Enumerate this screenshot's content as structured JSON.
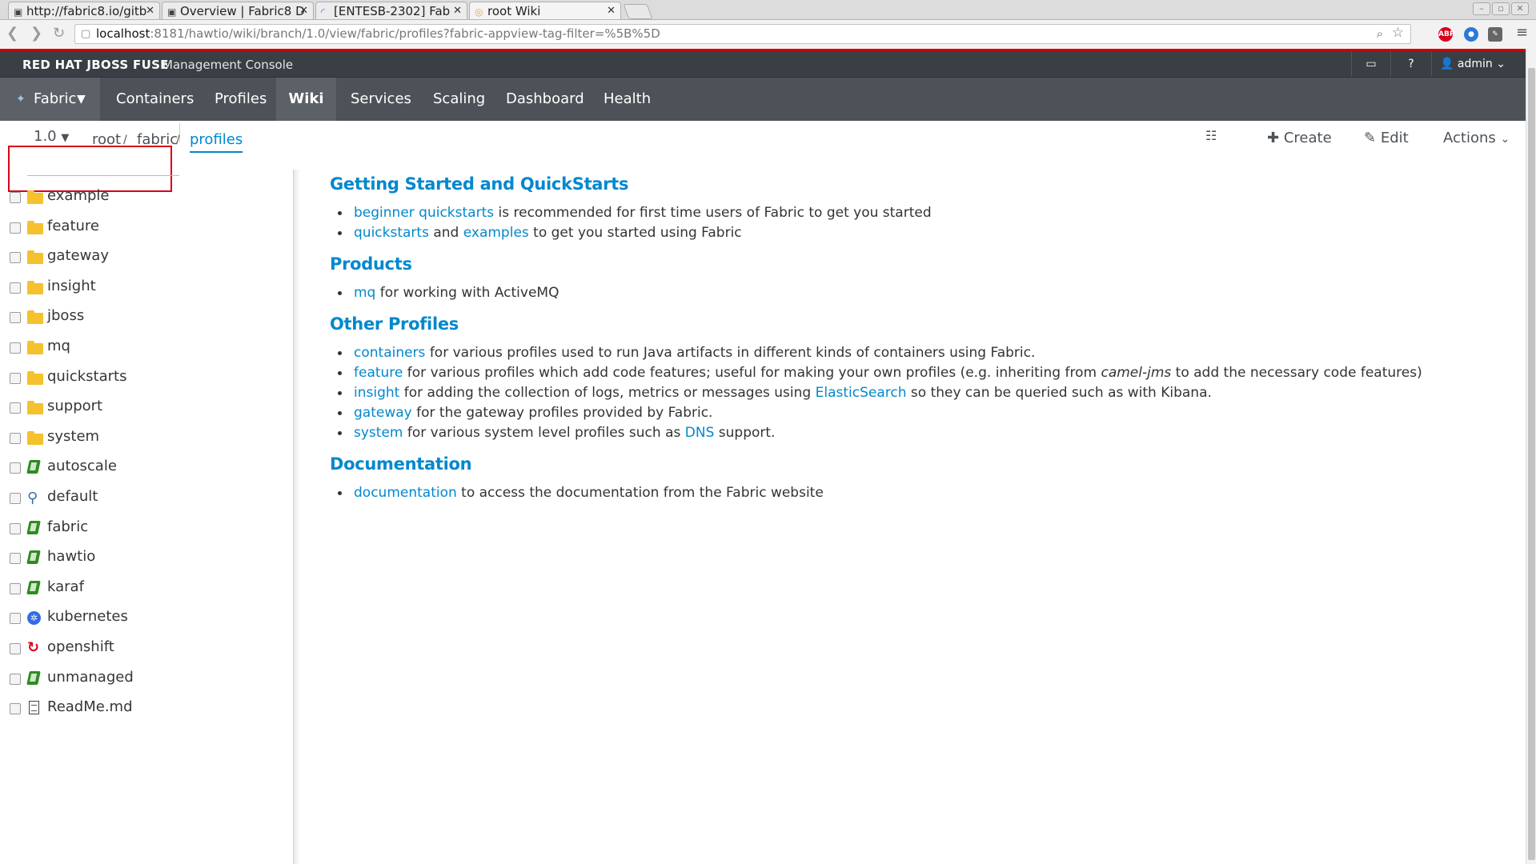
{
  "browser": {
    "tabs": [
      {
        "title": "http://fabric8.io/gitb"
      },
      {
        "title": "Overview | Fabric8 D"
      },
      {
        "title": "[ENTESB-2302] Fab"
      },
      {
        "title": "root Wiki"
      }
    ],
    "url_host": "localhost",
    "url_rest": ":8181/hawtio/wiki/branch/1.0/view/fabric/profiles?fabric-appview-tag-filter=%5B%5D"
  },
  "header": {
    "brand": "RED HAT JBOSS FUSE",
    "subtitle": "Management Console",
    "user": "admin"
  },
  "nav": {
    "fabric": "Fabric",
    "items": [
      "Containers",
      "Profiles",
      "Wiki",
      "Services",
      "Scaling",
      "Dashboard",
      "Health"
    ]
  },
  "toolbar": {
    "version": "1.0",
    "breadcrumb": [
      "root",
      "fabric",
      "profiles"
    ],
    "create": "Create",
    "edit": "Edit",
    "actions": "Actions"
  },
  "tree": [
    {
      "label": "example",
      "icon": "folder-icon"
    },
    {
      "label": "feature",
      "icon": "folder-icon"
    },
    {
      "label": "gateway",
      "icon": "folder-icon"
    },
    {
      "label": "insight",
      "icon": "folder-icon"
    },
    {
      "label": "jboss",
      "icon": "folder-icon"
    },
    {
      "label": "mq",
      "icon": "folder-icon"
    },
    {
      "label": "quickstarts",
      "icon": "folder-icon"
    },
    {
      "label": "support",
      "icon": "folder-icon"
    },
    {
      "label": "system",
      "icon": "folder-icon"
    },
    {
      "label": "autoscale",
      "icon": "book-icon"
    },
    {
      "label": "default",
      "icon": "default-profile-icon"
    },
    {
      "label": "fabric",
      "icon": "book-icon"
    },
    {
      "label": "hawtio",
      "icon": "book-icon"
    },
    {
      "label": "karaf",
      "icon": "book-icon"
    },
    {
      "label": "kubernetes",
      "icon": "kubernetes-icon"
    },
    {
      "label": "openshift",
      "icon": "openshift-icon"
    },
    {
      "label": "unmanaged",
      "icon": "book-icon"
    },
    {
      "label": "ReadMe.md",
      "icon": "document-icon"
    }
  ],
  "content": {
    "s1": {
      "title": "Getting Started and QuickStarts",
      "b1": {
        "link": "beginner quickstarts",
        "text": " is recommended for first time users of Fabric to get you started"
      },
      "b2": {
        "link1": "quickstarts",
        "mid": " and ",
        "link2": "examples",
        "text": " to get you started using Fabric"
      }
    },
    "s2": {
      "title": "Products",
      "b1": {
        "link": "mq",
        "text": " for working with ActiveMQ"
      }
    },
    "s3": {
      "title": "Other Profiles",
      "b1": {
        "link": "containers",
        "text": " for various profiles used to run Java artifacts in different kinds of containers using Fabric."
      },
      "b2": {
        "link": "feature",
        "text": " for various profiles which add code features; useful for making your own profiles (e.g. inheriting from ",
        "em": "camel-jms",
        "text2": " to add the necessary code features)"
      },
      "b3": {
        "link": "insight",
        "text": " for adding the collection of logs, metrics or messages using ",
        "link2": "ElasticSearch",
        "text2": " so they can be queried such as with Kibana."
      },
      "b4": {
        "link": "gateway",
        "text": " for the gateway profiles provided by Fabric."
      },
      "b5": {
        "link": "system",
        "text": " for various system level profiles such as ",
        "link2": "DNS",
        "text2": " support."
      }
    },
    "s4": {
      "title": "Documentation",
      "b1": {
        "link": "documentation",
        "text": " to access the documentation from the Fabric website"
      }
    }
  }
}
